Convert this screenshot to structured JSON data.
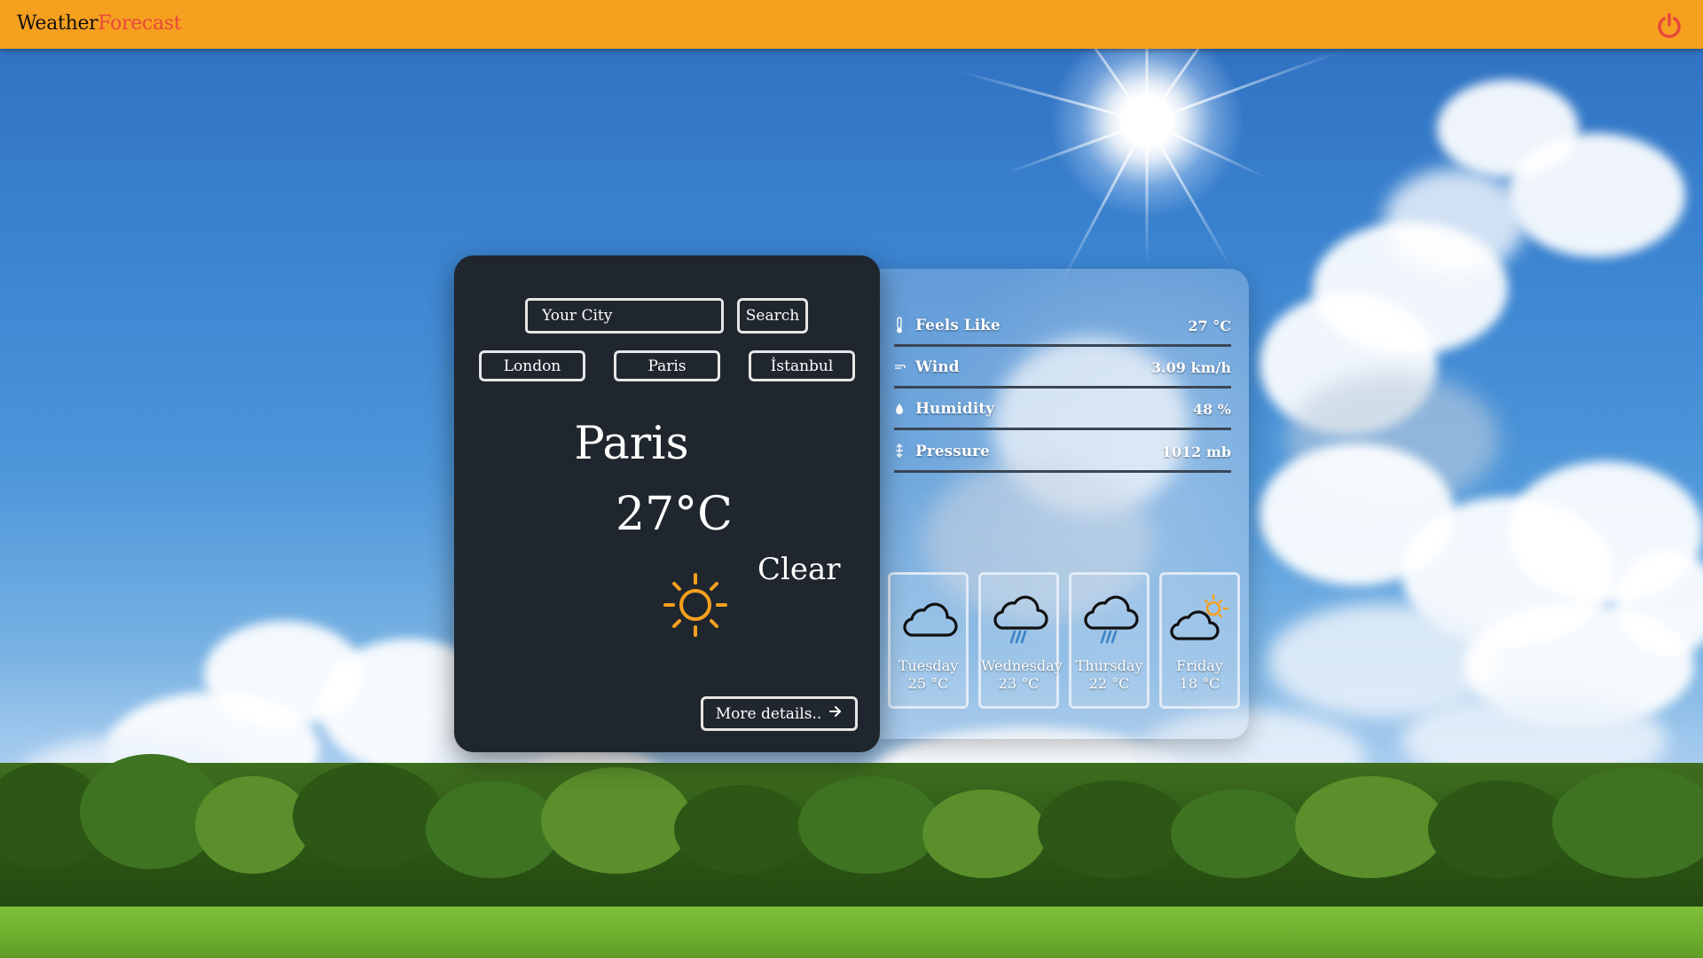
{
  "header": {
    "brand_part1": "Weather",
    "brand_part2": "Forecast",
    "power_icon": "power-icon"
  },
  "search": {
    "placeholder": "Your City",
    "button_label": "Search"
  },
  "quick_cities": [
    "London",
    "Paris",
    "İstanbul"
  ],
  "current": {
    "city": "Paris",
    "temperature": "27°C",
    "condition": "Clear",
    "icon": "sun-icon",
    "more_details_label": "More details.."
  },
  "details": [
    {
      "icon": "thermometer-icon",
      "label": "Feels Like",
      "value": "27 °C"
    },
    {
      "icon": "wind-icon",
      "label": "Wind",
      "value": "3.09 km/h"
    },
    {
      "icon": "droplet-icon",
      "label": "Humidity",
      "value": "48 %"
    },
    {
      "icon": "pressure-icon",
      "label": "Pressure",
      "value": "1012 mb"
    }
  ],
  "forecast": [
    {
      "day": "Tuesday",
      "temp": "25 °C",
      "icon": "cloud-icon"
    },
    {
      "day": "Wednesday",
      "temp": "23 °C",
      "icon": "cloud-rain-icon"
    },
    {
      "day": "Thursday",
      "temp": "22 °C",
      "icon": "cloud-rain-icon"
    },
    {
      "day": "Friday",
      "temp": "18 °C",
      "icon": "cloud-sun-icon"
    }
  ],
  "colors": {
    "header_bg": "#f6a01f",
    "brand_accent": "#e8473d",
    "card_bg": "#20262e",
    "sun_icon": "#f6a01f"
  }
}
